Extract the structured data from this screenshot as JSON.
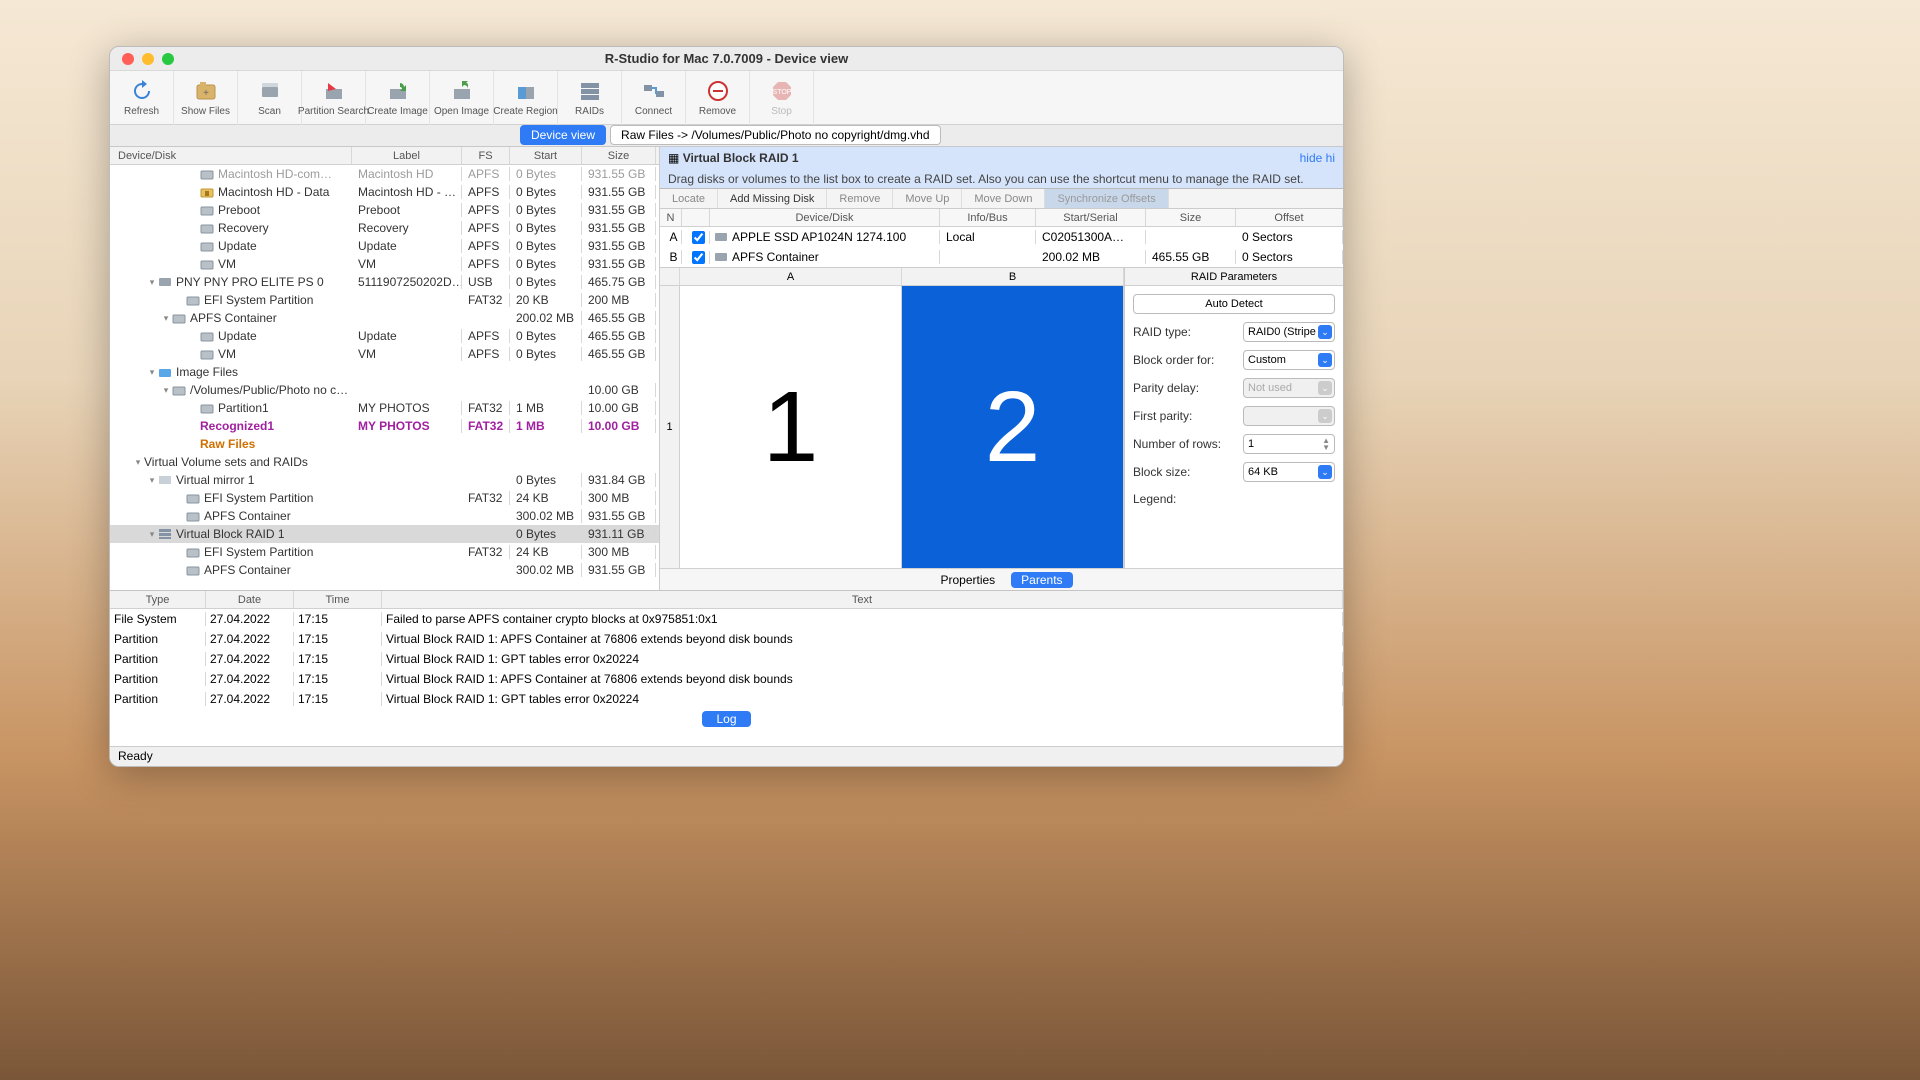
{
  "window_title": "R-Studio for Mac 7.0.7009 - Device view",
  "toolbar": [
    {
      "id": "refresh",
      "label": "Refresh"
    },
    {
      "id": "show-files",
      "label": "Show Files"
    },
    {
      "id": "scan",
      "label": "Scan"
    },
    {
      "id": "partition-search",
      "label": "Partition Search"
    },
    {
      "id": "create-image",
      "label": "Create Image"
    },
    {
      "id": "open-image",
      "label": "Open Image"
    },
    {
      "id": "create-region",
      "label": "Create Region"
    },
    {
      "id": "raids",
      "label": "RAIDs"
    },
    {
      "id": "connect",
      "label": "Connect"
    },
    {
      "id": "remove",
      "label": "Remove"
    },
    {
      "id": "stop",
      "label": "Stop",
      "disabled": true
    }
  ],
  "tabs": [
    {
      "label": "Device view",
      "active": true
    },
    {
      "label": "Raw Files -> /Volumes/Public/Photo no copyright/dmg.vhd",
      "active": false
    }
  ],
  "tree": {
    "columns": [
      "Device/Disk",
      "Label",
      "FS",
      "Start",
      "Size"
    ],
    "rows": [
      {
        "indent": 5,
        "icon": "vol",
        "name": "Macintosh HD-com…",
        "label": "Macintosh HD",
        "fs": "APFS",
        "start": "0 Bytes",
        "size": "931.55 GB",
        "cls": "gray"
      },
      {
        "indent": 5,
        "icon": "vol-lock",
        "name": "Macintosh HD - Data",
        "label": "Macintosh HD - …",
        "fs": "APFS",
        "start": "0 Bytes",
        "size": "931.55 GB"
      },
      {
        "indent": 5,
        "icon": "vol",
        "name": "Preboot",
        "label": "Preboot",
        "fs": "APFS",
        "start": "0 Bytes",
        "size": "931.55 GB"
      },
      {
        "indent": 5,
        "icon": "vol",
        "name": "Recovery",
        "label": "Recovery",
        "fs": "APFS",
        "start": "0 Bytes",
        "size": "931.55 GB"
      },
      {
        "indent": 5,
        "icon": "vol",
        "name": "Update",
        "label": "Update",
        "fs": "APFS",
        "start": "0 Bytes",
        "size": "931.55 GB"
      },
      {
        "indent": 5,
        "icon": "vol",
        "name": "VM",
        "label": "VM",
        "fs": "APFS",
        "start": "0 Bytes",
        "size": "931.55 GB"
      },
      {
        "indent": 2,
        "icon": "disk",
        "chev": "down",
        "name": "PNY PNY PRO ELITE PS 0",
        "label": "5111907250202D…",
        "fs": "USB",
        "start": "0 Bytes",
        "size": "465.75 GB"
      },
      {
        "indent": 4,
        "icon": "vol",
        "name": "EFI System Partition",
        "label": "",
        "fs": "FAT32",
        "start": "20 KB",
        "size": "200 MB"
      },
      {
        "indent": 3,
        "icon": "vol",
        "chev": "down",
        "name": "APFS Container",
        "label": "",
        "fs": "",
        "start": "200.02 MB",
        "size": "465.55 GB"
      },
      {
        "indent": 5,
        "icon": "vol",
        "name": "Update",
        "label": "Update",
        "fs": "APFS",
        "start": "0 Bytes",
        "size": "465.55 GB"
      },
      {
        "indent": 5,
        "icon": "vol",
        "name": "VM",
        "label": "VM",
        "fs": "APFS",
        "start": "0 Bytes",
        "size": "465.55 GB"
      },
      {
        "indent": 2,
        "icon": "folder",
        "chev": "down",
        "name": "Image Files",
        "label": "",
        "fs": "",
        "start": "",
        "size": ""
      },
      {
        "indent": 3,
        "icon": "vol",
        "chev": "down",
        "name": "/Volumes/Public/Photo no c…",
        "label": "",
        "fs": "",
        "start": "",
        "size": "10.00 GB"
      },
      {
        "indent": 5,
        "icon": "vol",
        "name": "Partition1",
        "label": "MY PHOTOS",
        "fs": "FAT32",
        "start": "1 MB",
        "size": "10.00 GB"
      },
      {
        "indent": 5,
        "icon": "",
        "name": "Recognized1",
        "label": "MY PHOTOS",
        "fs": "FAT32",
        "start": "1 MB",
        "size": "10.00 GB",
        "cls": "purple"
      },
      {
        "indent": 5,
        "icon": "",
        "name": "Raw Files",
        "label": "",
        "fs": "",
        "start": "",
        "size": "",
        "cls": "orange"
      },
      {
        "indent": 1,
        "icon": "",
        "chev": "down",
        "name": "Virtual Volume sets and RAIDs",
        "label": "",
        "fs": "",
        "start": "",
        "size": ""
      },
      {
        "indent": 2,
        "icon": "vdisk",
        "chev": "down",
        "name": "Virtual mirror 1",
        "label": "",
        "fs": "",
        "start": "0 Bytes",
        "size": "931.84 GB"
      },
      {
        "indent": 4,
        "icon": "vol",
        "name": "EFI System Partition",
        "label": "",
        "fs": "FAT32",
        "start": "24 KB",
        "size": "300 MB"
      },
      {
        "indent": 4,
        "icon": "vol",
        "name": "APFS Container",
        "label": "",
        "fs": "",
        "start": "300.02 MB",
        "size": "931.55 GB"
      },
      {
        "indent": 2,
        "icon": "raid",
        "chev": "down",
        "name": "Virtual Block RAID 1",
        "label": "",
        "fs": "",
        "start": "0 Bytes",
        "size": "931.11 GB",
        "cls": "sel"
      },
      {
        "indent": 4,
        "icon": "vol",
        "name": "EFI System Partition",
        "label": "",
        "fs": "FAT32",
        "start": "24 KB",
        "size": "300 MB"
      },
      {
        "indent": 4,
        "icon": "vol",
        "name": "APFS Container",
        "label": "",
        "fs": "",
        "start": "300.02 MB",
        "size": "931.55 GB"
      }
    ]
  },
  "raid": {
    "title": "Virtual Block RAID 1",
    "hide": "hide hi",
    "instruction": "Drag disks or volumes to the list box to create a RAID set. Also you can use the shortcut menu to manage the RAID set.",
    "toolbar": [
      {
        "label": "Locate",
        "active": false
      },
      {
        "label": "Add Missing Disk",
        "active": true
      },
      {
        "label": "Remove",
        "active": false
      },
      {
        "label": "Move Up",
        "active": false
      },
      {
        "label": "Move Down",
        "active": false
      },
      {
        "label": "Synchronize Offsets",
        "active": false,
        "sync": true
      }
    ],
    "columns": [
      "N",
      "",
      "Device/Disk",
      "Info/Bus",
      "Start/Serial",
      "Size",
      "Offset"
    ],
    "rows": [
      {
        "n": "A",
        "chk": true,
        "dev": "APPLE SSD AP1024N 1274.100",
        "info": "Local",
        "start": "C02051300A…",
        "size": "",
        "off": "0 Sectors"
      },
      {
        "n": "B",
        "chk": true,
        "dev": "APFS Container",
        "info": "",
        "start": "200.02 MB",
        "size": "465.55 GB",
        "off": "0 Sectors"
      }
    ],
    "block_cols": [
      "A",
      "B"
    ],
    "block_row": "1",
    "cells": [
      "1",
      "2"
    ]
  },
  "params": {
    "header": "RAID Parameters",
    "auto": "Auto Detect",
    "rows": [
      {
        "l": "RAID type:",
        "v": "RAID0 (Stripe",
        "t": "sel"
      },
      {
        "l": "Block order for:",
        "v": "Custom",
        "t": "sel"
      },
      {
        "l": "Parity delay:",
        "v": "Not used",
        "t": "sel",
        "dis": true
      },
      {
        "l": "First parity:",
        "v": "",
        "t": "sel",
        "dis": true
      },
      {
        "l": "Number of rows:",
        "v": "1",
        "t": "step"
      },
      {
        "l": "Block size:",
        "v": "64 KB",
        "t": "sel"
      }
    ],
    "legend": "Legend:"
  },
  "pt_tabs": [
    {
      "label": "Properties"
    },
    {
      "label": "Parents",
      "active": true
    }
  ],
  "log": {
    "columns": [
      "Type",
      "Date",
      "Time",
      "Text"
    ],
    "rows": [
      {
        "t": "File System",
        "d": "27.04.2022",
        "tm": "17:15",
        "x": "Failed to parse APFS container crypto blocks at 0x975851:0x1"
      },
      {
        "t": "Partition",
        "d": "27.04.2022",
        "tm": "17:15",
        "x": "Virtual Block RAID 1: APFS Container at 76806 extends beyond disk bounds"
      },
      {
        "t": "Partition",
        "d": "27.04.2022",
        "tm": "17:15",
        "x": "Virtual Block RAID 1: GPT tables error 0x20224"
      },
      {
        "t": "Partition",
        "d": "27.04.2022",
        "tm": "17:15",
        "x": "Virtual Block RAID 1: APFS Container at 76806 extends beyond disk bounds"
      },
      {
        "t": "Partition",
        "d": "27.04.2022",
        "tm": "17:15",
        "x": "Virtual Block RAID 1: GPT tables error 0x20224"
      }
    ],
    "button": "Log"
  },
  "status": "Ready"
}
